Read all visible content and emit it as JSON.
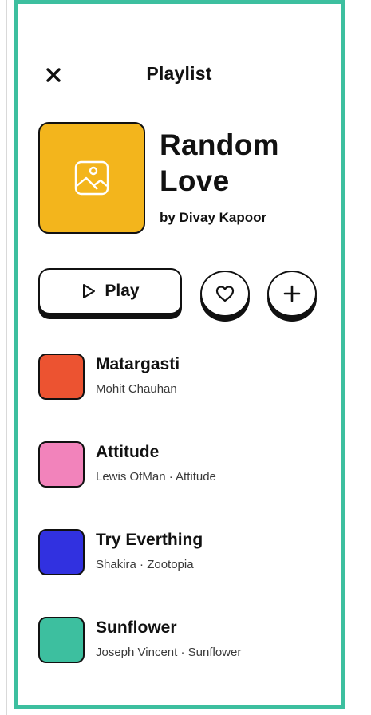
{
  "header": {
    "title": "Playlist",
    "close_icon": "close-icon"
  },
  "playlist": {
    "title": "Random Love",
    "author": "by Divay Kapoor",
    "cover_color": "#f3b51c",
    "cover_icon": "image-icon"
  },
  "actions": {
    "play_label": "Play",
    "play_icon": "play-outline-icon",
    "like_icon": "heart-outline-icon",
    "add_icon": "plus-icon"
  },
  "tracks": [
    {
      "title": "Matargasti",
      "subtitle": "Mohit Chauhan",
      "color": "#ec5331"
    },
    {
      "title": "Attitude",
      "subtitle": "Lewis OfMan · Attitude",
      "color": "#f283bb"
    },
    {
      "title": "Try Everthing",
      "subtitle": "Shakira · Zootopia",
      "color": "#3131e0"
    },
    {
      "title": "Sunflower",
      "subtitle": "Joseph Vincent · Sunflower",
      "color": "#3dbf9f"
    }
  ],
  "theme": {
    "frame_border": "#3dbf9f",
    "text": "#111111"
  }
}
